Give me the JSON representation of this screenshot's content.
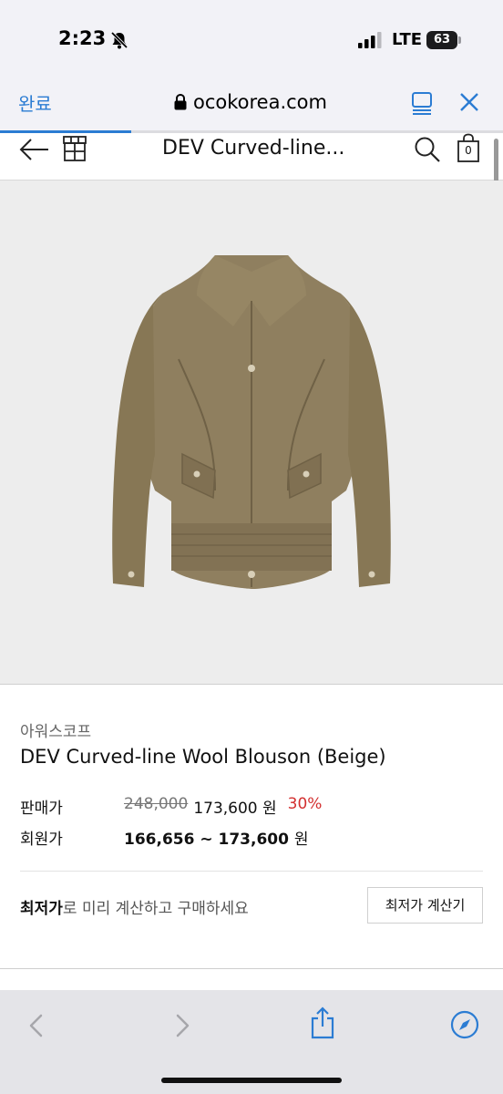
{
  "status_bar": {
    "time": "2:23",
    "network": "LTE",
    "battery": "63"
  },
  "browser": {
    "done_label": "완료",
    "url": "ocokorea.com",
    "load_progress": 0.26
  },
  "site_header": {
    "title": "DEV Curved-line...",
    "cart_count": "0"
  },
  "product": {
    "brand": "아워스코프",
    "name": "DEV Curved-line Wool Blouson (Beige)",
    "sale_label": "판매가",
    "original_price": "248,000",
    "sale_price": "173,600 원",
    "discount": "30%",
    "member_label": "회원가",
    "member_price": "166,656 ~ 173,600",
    "member_unit": "원"
  },
  "lowest": {
    "strong": "최저가",
    "rest": "로 미리 계산하고 구매하세요",
    "button": "최저가 계산기"
  },
  "colors": {
    "accent": "#2b7cd3",
    "discount": "#d32f2f",
    "jacket": "#8f7f5f"
  },
  "icons": [
    "bell-slash-icon",
    "signal-icon",
    "lock-icon",
    "reader-icon",
    "close-icon",
    "back-arrow-icon",
    "store-icon",
    "search-icon",
    "cart-icon",
    "back-icon",
    "forward-icon",
    "share-icon",
    "compass-icon"
  ]
}
